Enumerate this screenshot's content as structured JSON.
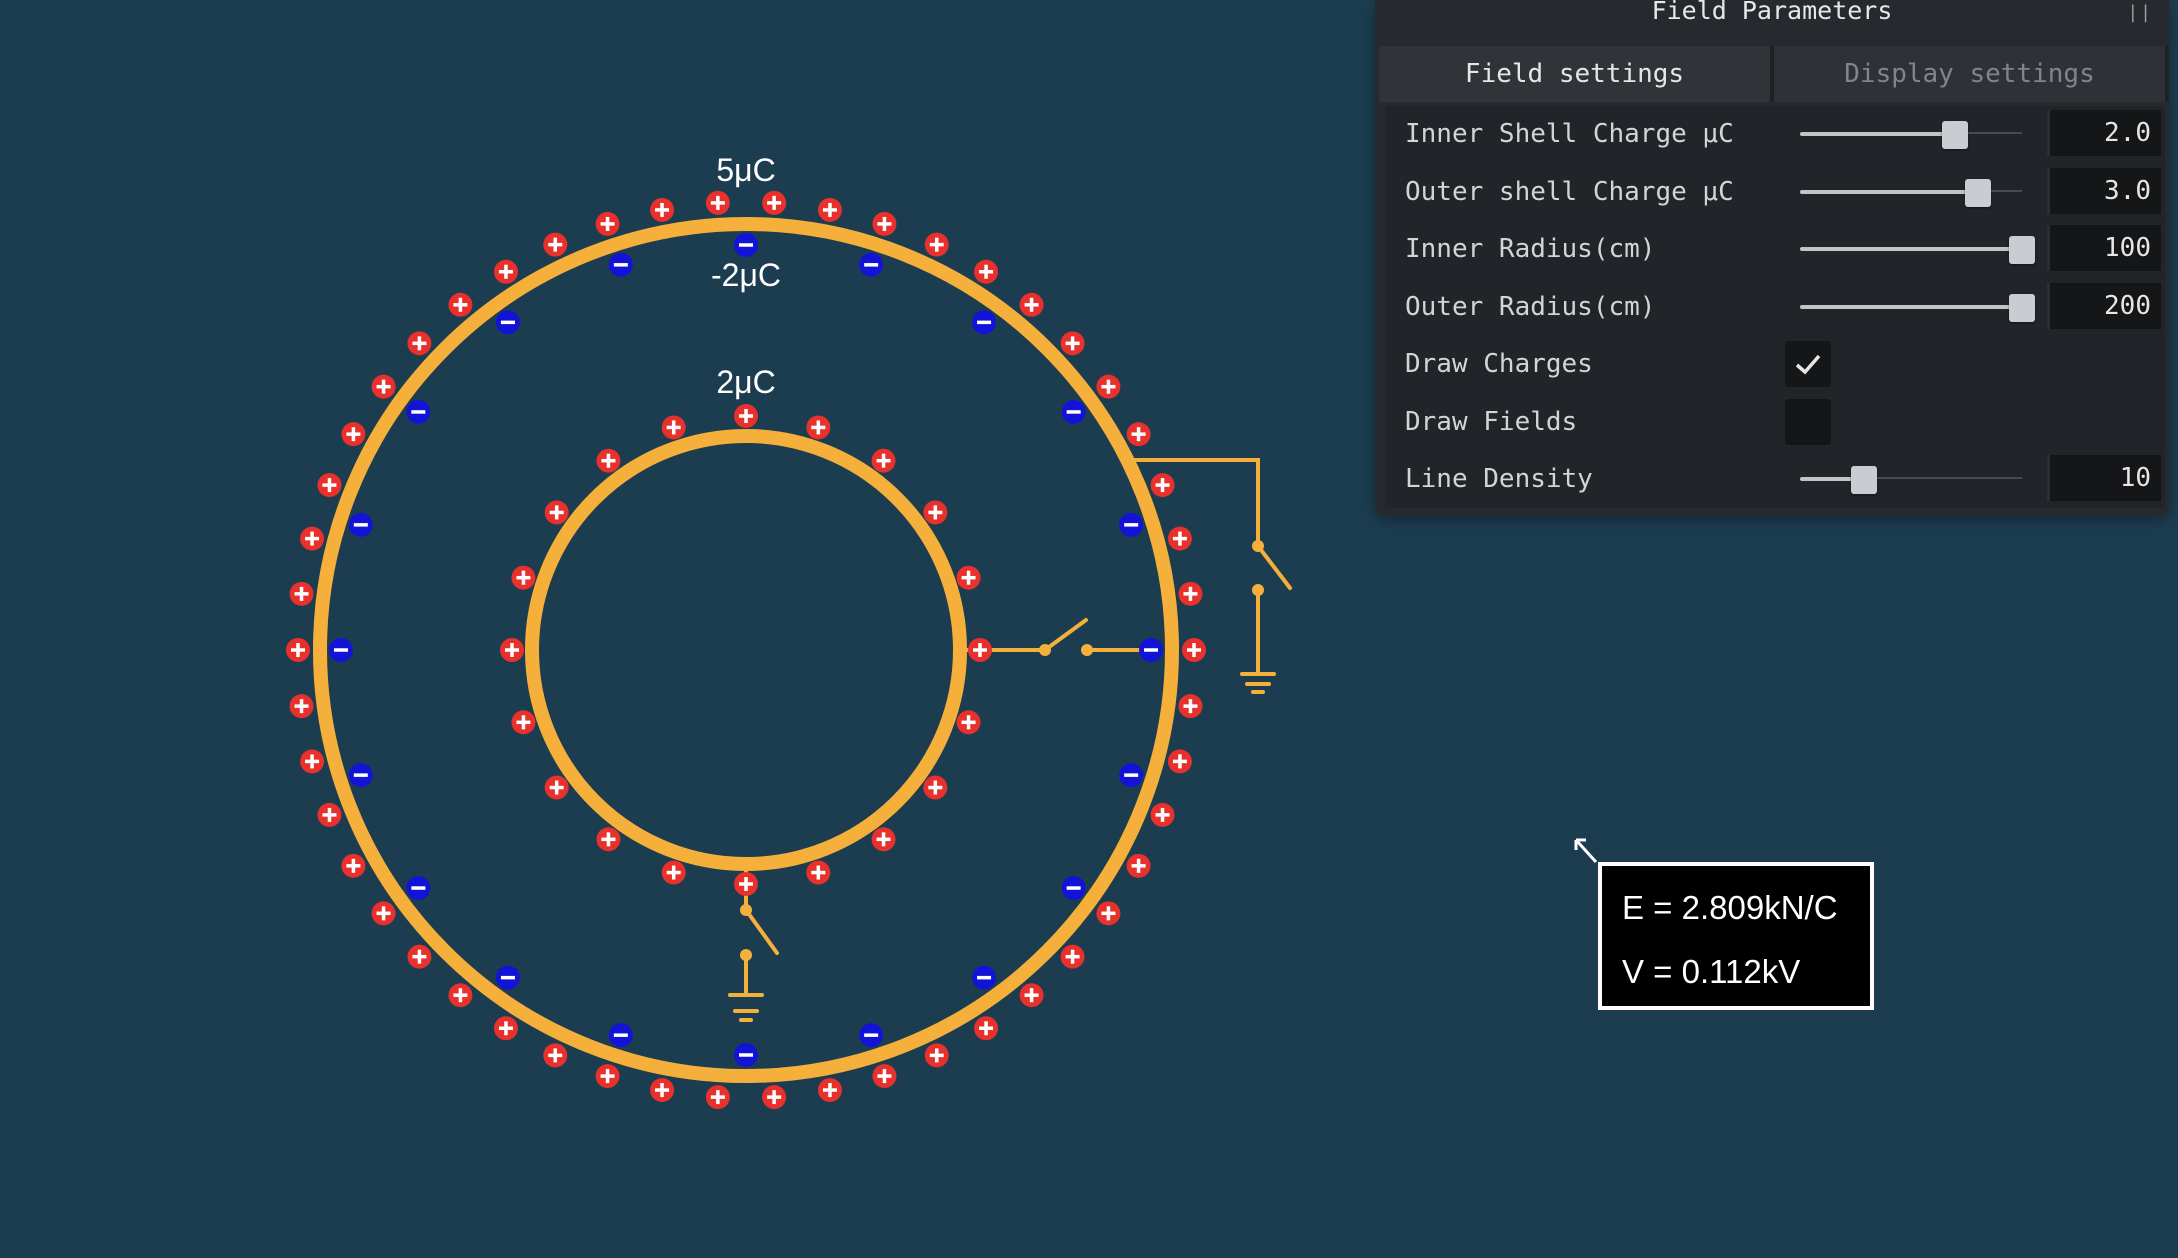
{
  "panel": {
    "title": "Field Parameters",
    "tabs": [
      {
        "label": "Field settings",
        "active": true
      },
      {
        "label": "Display settings",
        "active": false
      }
    ],
    "rows": {
      "inner_charge": {
        "label": "Inner Shell Charge μC",
        "value": "2.0",
        "slider_fraction": 0.7
      },
      "outer_charge": {
        "label": "Outer shell Charge μC",
        "value": "3.0",
        "slider_fraction": 0.8
      },
      "inner_radius": {
        "label": "Inner Radius(cm)",
        "value": "100",
        "slider_fraction": 1.0
      },
      "outer_radius": {
        "label": "Outer Radius(cm)",
        "value": "200",
        "slider_fraction": 1.0
      },
      "draw_charges": {
        "label": "Draw Charges",
        "checked": true
      },
      "draw_fields": {
        "label": "Draw Fields",
        "checked": false
      },
      "line_density": {
        "label": "Line Density",
        "value": "10",
        "slider_fraction": 0.29
      }
    }
  },
  "diagram": {
    "outer_shell_outer_label": "5μC",
    "outer_shell_inner_label": "-2μC",
    "inner_shell_label": "2μC",
    "colors": {
      "shell": "#f5b03b",
      "positive": "#e8302c",
      "negative": "#1313d8",
      "background": "#1c3d50"
    },
    "icons": [
      "switch-icon",
      "ground-icon"
    ]
  },
  "readout": {
    "field": "E = 2.809kN/C",
    "potential": "V = 0.112kV"
  }
}
